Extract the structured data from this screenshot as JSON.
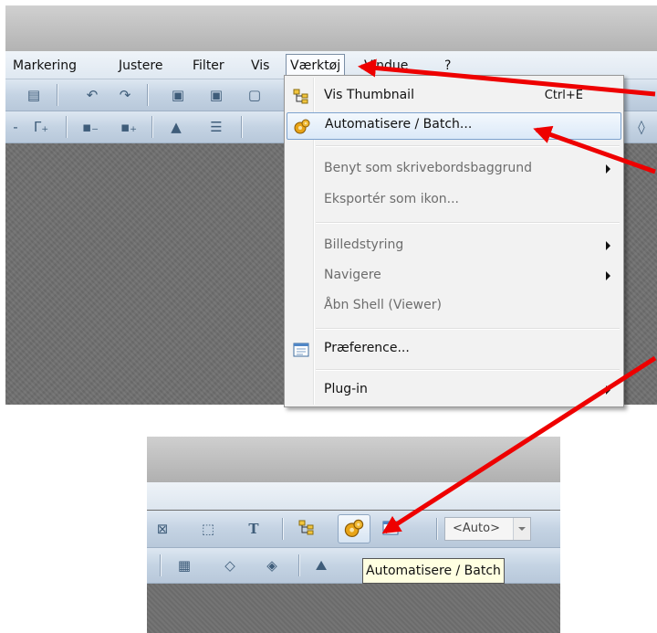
{
  "menubar": {
    "items": [
      "Markering",
      "Justere",
      "Filter",
      "Vis",
      "Værktøj",
      "Vindue",
      "?"
    ],
    "active_index": 4
  },
  "dropdown": {
    "items": [
      {
        "label": "Vis Thumbnail",
        "shortcut": "Ctrl+E",
        "enabled": true,
        "submenu": false,
        "icon": "thumbnail-tree-icon"
      },
      {
        "label": "Automatisere / Batch...",
        "shortcut": "",
        "enabled": true,
        "submenu": false,
        "icon": "gear-batch-icon",
        "highlighted": true
      },
      {
        "label": "Benyt som skrivebordsbaggrund",
        "shortcut": "",
        "enabled": false,
        "submenu": true
      },
      {
        "label": "Eksportér som ikon...",
        "shortcut": "",
        "enabled": false,
        "submenu": false
      },
      {
        "label": "Billedstyring",
        "shortcut": "",
        "enabled": false,
        "submenu": true
      },
      {
        "label": "Navigere",
        "shortcut": "",
        "enabled": false,
        "submenu": true
      },
      {
        "label": "Åbn Shell (Viewer)",
        "shortcut": "",
        "enabled": false,
        "submenu": false
      },
      {
        "label": "Præference...",
        "shortcut": "",
        "enabled": true,
        "submenu": false,
        "icon": "preferences-window-icon"
      },
      {
        "label": "Plug-in",
        "shortcut": "",
        "enabled": true,
        "submenu": true
      }
    ]
  },
  "bottom_toolbar": {
    "zoom_select_value": "<Auto>",
    "tooltip": "Automatisere / Batch"
  },
  "colors": {
    "arrow": "#ee0000",
    "highlight_border": "#7da2ce",
    "tooltip_bg": "#ffffe1"
  }
}
